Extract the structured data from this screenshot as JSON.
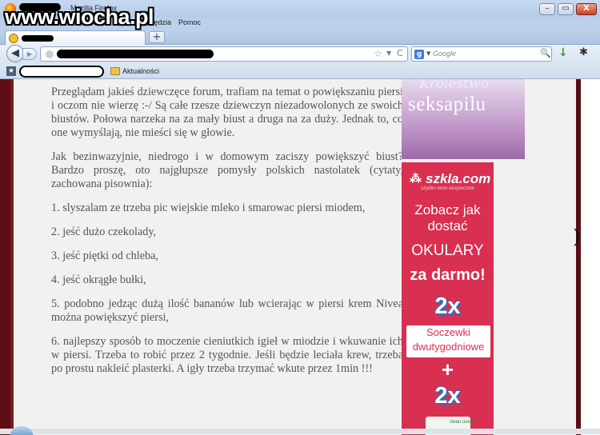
{
  "window": {
    "title": "Mozilla Firefox",
    "watermark": "www.wiocha.pl",
    "controls": {
      "minimize": "–",
      "maximize": "▭",
      "close": "X"
    }
  },
  "menu": {
    "items": [
      "P",
      "arzędzia",
      "Pomoc"
    ]
  },
  "tabs": {
    "new_tab": "+"
  },
  "nav": {
    "back": "◀",
    "forward": "▶",
    "star": "☆",
    "dropdown": "▼",
    "reload": "C",
    "search_engine": "g",
    "search_placeholder": "Google",
    "search_button": "🔍",
    "download": "↓",
    "tools": "✱"
  },
  "bookmarks": {
    "item_label": "Aktualności"
  },
  "article": {
    "paragraphs": [
      "Przeglądam jakieś dziewczęce forum, trafiam na temat o powiększaniu piersi i oczom nie wierzę :-/ Są całe rzesze dziewczyn niezadowolonych ze swoich biustów. Połowa narzeka na za mały biust a druga na za duży. Jednak to, co one wymyślają, nie mieści się w głowie.",
      "Jak bezinwazyjnie, niedrogo i w domowym zaciszy powiększyć biust? Bardzo proszę, oto najgłupsze pomysły polskich nastolatek (cytaty, zachowana pisownia):",
      "1. slyszalam ze trzeba pic wiejskie mleko i smarowac piersi miodem,",
      "2. jeść dużo czekolady,",
      "3. jeść piętki od chleba,",
      "4. jeść okrągłe bułki,",
      "5. podobno jedząc dużą ilość bananów lub wcierając w piersi krem Nivea można powiększyć piersi,",
      "6. najlepszy sposób to moczenie cieniutkich igieł w miodzie i wkuwanie ich w piersi. Trzeba to robić przez 2 tygodnie. Jeśli będzie leciała krew, trzeba po prostu nakleić plasterki. A igły trzeba trzymać wkute przez 1min !!!"
    ]
  },
  "ad_top": {
    "overline": "Królestwo",
    "title": "seksapilu"
  },
  "ad_side": {
    "logo_mark": "⁂",
    "logo": "szkla.com",
    "tagline": "szybko tanio bezpiecznie",
    "line1": "Zobacz jak dostać",
    "line2": "OKULARY",
    "line3": "za darmo!",
    "badge1": "2x",
    "lens_text": "Soczewki dwutygodniowe",
    "plus": "+",
    "badge2": "2x",
    "product": "clean ocean"
  },
  "colors": {
    "chrome_blue": "#bcd0ea",
    "page_frame": "#5c0f14",
    "ad_red": "#d92f50",
    "ad_purple": "#b88bc0",
    "text_gray": "#555555"
  }
}
